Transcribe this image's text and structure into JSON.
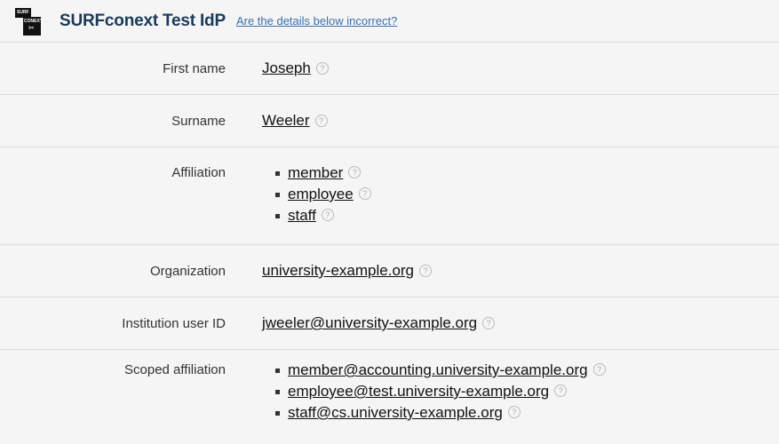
{
  "header": {
    "logo_text": "SURF conext",
    "idp_name": "SURFconext Test IdP",
    "incorrect_link": "Are the details below incorrect?"
  },
  "attributes": {
    "first_name": {
      "label": "First name",
      "value": "Joseph"
    },
    "surname": {
      "label": "Surname",
      "value": "Weeler"
    },
    "affiliation": {
      "label": "Affiliation",
      "values": [
        "member",
        "employee",
        "staff"
      ]
    },
    "organization": {
      "label": "Organization",
      "value": "university-example.org"
    },
    "institution_user_id": {
      "label": "Institution user ID",
      "value": "jweeler@university-example.org"
    },
    "scoped_affiliation": {
      "label": "Scoped affiliation",
      "values": [
        "member@accounting.university-example.org",
        "employee@test.university-example.org",
        "staff@cs.university-example.org"
      ]
    }
  },
  "help_icon": "?",
  "colors": {
    "background": "#f5f5f5",
    "title": "#1a3a5a",
    "link": "#3b6fb0",
    "divider": "#dcdcdc"
  }
}
